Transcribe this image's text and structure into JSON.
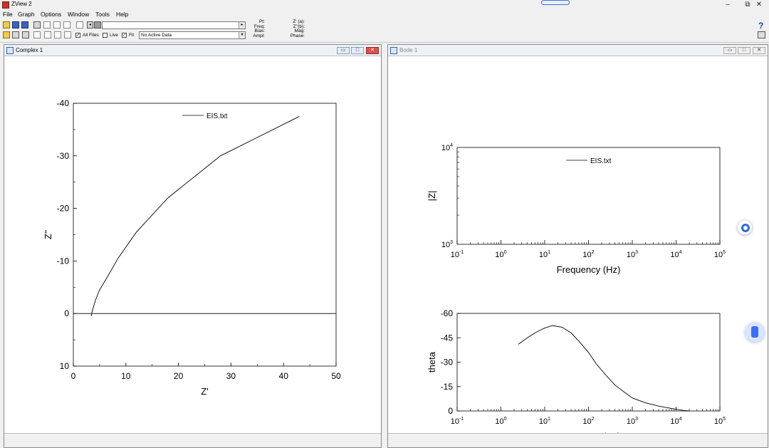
{
  "window": {
    "title": "ZView 2",
    "min": "–",
    "restore": "⧉",
    "close": "✕"
  },
  "menu": [
    "File",
    "Graph",
    "Options",
    "Window",
    "Tools",
    "Help"
  ],
  "toolbar": {
    "all_files_label": "All Files",
    "all_files_checked": true,
    "live_label": "Live",
    "live_checked": false,
    "fit_label": "Fit",
    "fit_checked": true,
    "active_data": "No Active Data",
    "info_left": [
      "Pt:",
      "Freq:",
      "Bias:",
      "Ampl:"
    ],
    "info_right": [
      "Z' (a):",
      "Z''(b):",
      "Mag:",
      "Phase:"
    ],
    "help_glyph": "?"
  },
  "windows": {
    "complex": {
      "title": "Complex 1"
    },
    "bode": {
      "title": "Bode 1"
    }
  },
  "chart_data": [
    {
      "type": "line",
      "name": "complex",
      "legend": [
        "EIS.txt"
      ],
      "xlabel": "Z'",
      "ylabel": "Z''",
      "xlim": [
        0,
        50
      ],
      "ylim": [
        10,
        -40
      ],
      "xticks": [
        "0",
        "10",
        "20",
        "30",
        "40",
        "50"
      ],
      "yticks": [
        "-40",
        "-30",
        "-20",
        "-10",
        "0",
        "10"
      ],
      "series": [
        {
          "x": [
            3.4,
            3.6,
            4.2,
            5.0,
            6.5,
            8.5,
            12,
            18,
            28,
            36,
            43
          ],
          "y": [
            0.5,
            -0.5,
            -2.5,
            -4.5,
            -7.0,
            -10.5,
            -15.5,
            -22,
            -30,
            -34,
            -37.5
          ]
        }
      ]
    },
    {
      "type": "line",
      "name": "bode_magnitude",
      "legend": [
        "EIS.txt"
      ],
      "xlabel": "Frequency (Hz)",
      "ylabel": "|Z|",
      "xscale": "log",
      "yscale": "log",
      "xlim": [
        0.1,
        100000
      ],
      "ylim": [
        1000,
        10000
      ],
      "xticks": [
        {
          "b": "10",
          "e": "-1"
        },
        {
          "b": "10",
          "e": "0"
        },
        {
          "b": "10",
          "e": "1"
        },
        {
          "b": "10",
          "e": "2"
        },
        {
          "b": "10",
          "e": "3"
        },
        {
          "b": "10",
          "e": "4"
        },
        {
          "b": "10",
          "e": "5"
        }
      ],
      "yticks": [
        {
          "b": "10",
          "e": "3"
        },
        {
          "b": "10",
          "e": "4"
        }
      ],
      "series": []
    },
    {
      "type": "line",
      "name": "bode_phase",
      "xlabel": "Frequency (Hz)",
      "ylabel": "theta",
      "xscale": "log",
      "xlim": [
        0.1,
        100000
      ],
      "ylim": [
        0,
        -60
      ],
      "xticks": [
        {
          "b": "10",
          "e": "-1"
        },
        {
          "b": "10",
          "e": "0"
        },
        {
          "b": "10",
          "e": "1"
        },
        {
          "b": "10",
          "e": "2"
        },
        {
          "b": "10",
          "e": "3"
        },
        {
          "b": "10",
          "e": "4"
        },
        {
          "b": "10",
          "e": "5"
        }
      ],
      "yticks": [
        "-60",
        "-45",
        "-30",
        "-15",
        "0"
      ],
      "series": [
        {
          "x": [
            2.5,
            4,
            6,
            10,
            15,
            25,
            40,
            60,
            100,
            150,
            250,
            400,
            700,
            1000,
            2000,
            4000,
            8000,
            15000,
            20000
          ],
          "y": [
            -41,
            -45,
            -48,
            -51,
            -52.5,
            -51.5,
            -48,
            -43,
            -36,
            -29,
            -22,
            -16,
            -11,
            -8,
            -5,
            -3,
            -1.5,
            -0.3,
            0
          ]
        }
      ]
    }
  ]
}
